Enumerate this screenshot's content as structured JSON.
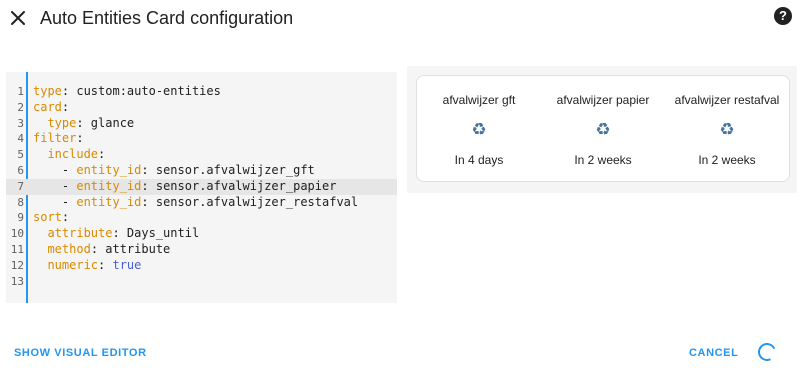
{
  "dialog": {
    "title": "Auto Entities Card configuration",
    "help_label": "?"
  },
  "editor": {
    "lines": [
      {
        "num": "1",
        "segments": [
          {
            "t": "type",
            "c": "key"
          },
          {
            "t": ": custom:auto-entities",
            "c": ""
          }
        ]
      },
      {
        "num": "2",
        "segments": [
          {
            "t": "card",
            "c": "key"
          },
          {
            "t": ":",
            "c": ""
          }
        ]
      },
      {
        "num": "3",
        "segments": [
          {
            "t": "  ",
            "c": ""
          },
          {
            "t": "type",
            "c": "key"
          },
          {
            "t": ": glance",
            "c": ""
          }
        ]
      },
      {
        "num": "4",
        "segments": [
          {
            "t": "filter",
            "c": "key"
          },
          {
            "t": ":",
            "c": ""
          }
        ]
      },
      {
        "num": "5",
        "segments": [
          {
            "t": "  ",
            "c": ""
          },
          {
            "t": "include",
            "c": "key"
          },
          {
            "t": ":",
            "c": ""
          }
        ]
      },
      {
        "num": "6",
        "segments": [
          {
            "t": "    - ",
            "c": ""
          },
          {
            "t": "entity_id",
            "c": "key"
          },
          {
            "t": ": sensor.afvalwijzer_gft",
            "c": ""
          }
        ]
      },
      {
        "num": "7",
        "segments": [
          {
            "t": "    - ",
            "c": ""
          },
          {
            "t": "entity_id",
            "c": "key"
          },
          {
            "t": ": sensor.afvalwijzer_papier",
            "c": ""
          }
        ],
        "active": true
      },
      {
        "num": "8",
        "segments": [
          {
            "t": "    - ",
            "c": ""
          },
          {
            "t": "entity_id",
            "c": "key"
          },
          {
            "t": ": sensor.afvalwijzer_restafval",
            "c": ""
          }
        ]
      },
      {
        "num": "9",
        "segments": [
          {
            "t": "sort",
            "c": "key"
          },
          {
            "t": ":",
            "c": ""
          }
        ]
      },
      {
        "num": "10",
        "segments": [
          {
            "t": "  ",
            "c": ""
          },
          {
            "t": "attribute",
            "c": "key"
          },
          {
            "t": ": Days_until",
            "c": ""
          }
        ]
      },
      {
        "num": "11",
        "segments": [
          {
            "t": "  ",
            "c": ""
          },
          {
            "t": "method",
            "c": "key"
          },
          {
            "t": ": attribute",
            "c": ""
          }
        ]
      },
      {
        "num": "12",
        "segments": [
          {
            "t": "  ",
            "c": ""
          },
          {
            "t": "numeric",
            "c": "key"
          },
          {
            "t": ": ",
            "c": ""
          },
          {
            "t": "true",
            "c": "bool"
          }
        ]
      },
      {
        "num": "13",
        "segments": []
      }
    ]
  },
  "preview": {
    "entities": [
      {
        "name": "afvalwijzer gft",
        "icon": "recycle-icon",
        "state": "In 4 days"
      },
      {
        "name": "afvalwijzer papier",
        "icon": "recycle-icon",
        "state": "In 2 weeks"
      },
      {
        "name": "afvalwijzer restafval",
        "icon": "recycle-icon",
        "state": "In 2 weeks"
      }
    ]
  },
  "footer": {
    "show_visual_editor": "SHOW VISUAL EDITOR",
    "cancel": "CANCEL"
  },
  "colors": {
    "accent": "#2196f3",
    "yaml_key": "#d98a00",
    "yaml_bool": "#4a5fd8",
    "entity_icon": "#44739e"
  }
}
